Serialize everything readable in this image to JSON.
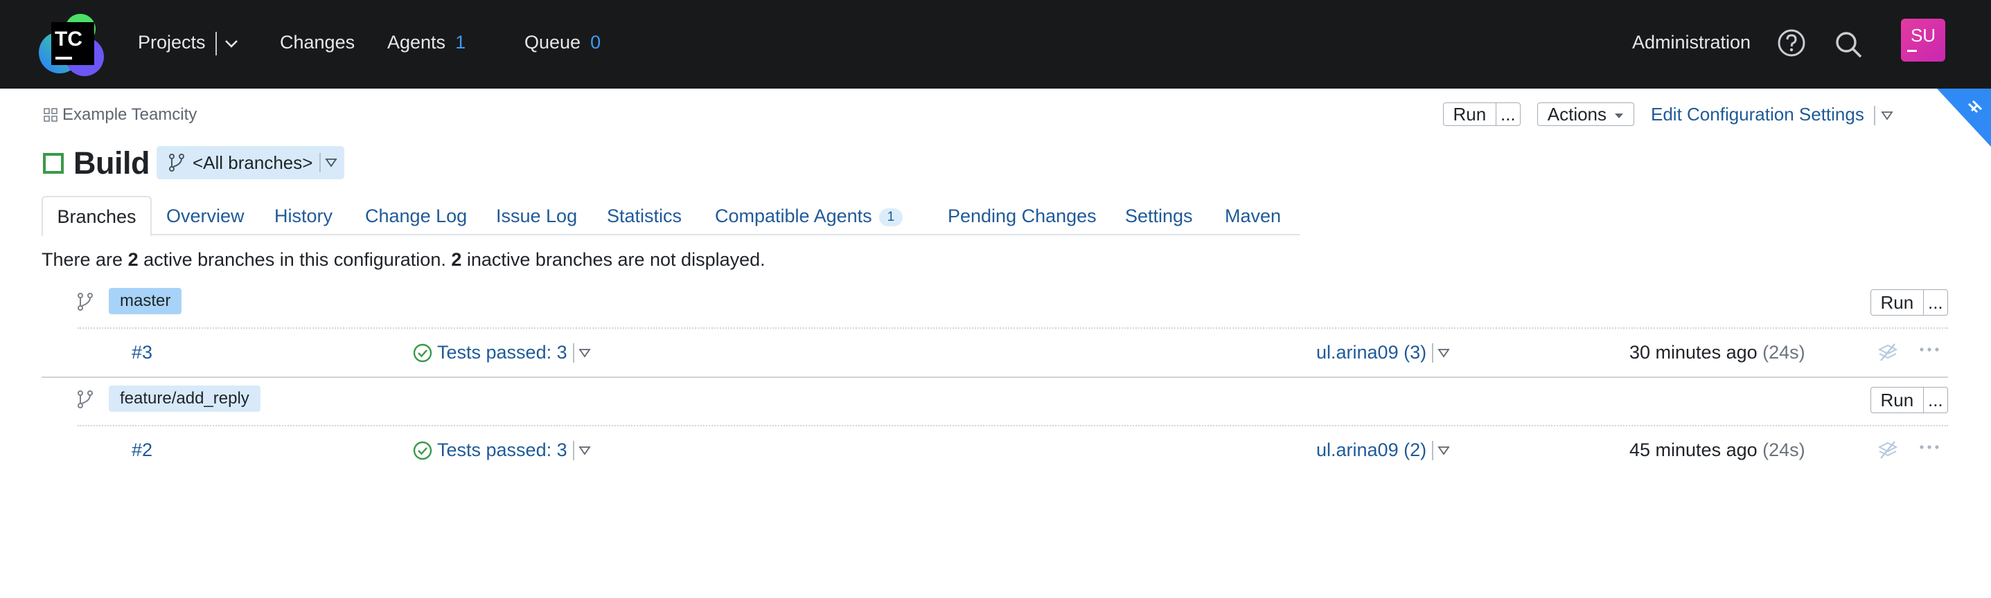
{
  "app": {
    "logo_text": "TC",
    "nav": {
      "projects": "Projects",
      "changes": "Changes",
      "agents": "Agents",
      "agents_count": "1",
      "queue": "Queue",
      "queue_count": "0",
      "administration": "Administration"
    },
    "avatar_initials": "SU",
    "colors": {
      "topbar": "#18191b",
      "link": "#1f5a99",
      "accent": "#3f99f2",
      "success": "#3b9a49",
      "avatar": "#d530a8"
    }
  },
  "header": {
    "breadcrumb": "Example Teamcity",
    "title": "Build",
    "branch_selector": "<All branches>",
    "run_label": "Run",
    "run_more_label": "...",
    "actions_label": "Actions",
    "edit_settings_label": "Edit Configuration Settings"
  },
  "tabs": [
    {
      "label": "Branches",
      "active": true
    },
    {
      "label": "Overview"
    },
    {
      "label": "History"
    },
    {
      "label": "Change Log"
    },
    {
      "label": "Issue Log"
    },
    {
      "label": "Statistics"
    },
    {
      "label": "Compatible Agents",
      "badge": "1"
    },
    {
      "label": "Pending Changes"
    },
    {
      "label": "Settings"
    },
    {
      "label": "Maven"
    }
  ],
  "summary": {
    "prefix": "There are ",
    "active_count": "2",
    "middle": " active branches in this configuration. ",
    "inactive_count": "2",
    "suffix": " inactive branches are not displayed."
  },
  "branches": [
    {
      "name": "master",
      "run_label": "Run",
      "more_label": "...",
      "build": {
        "number": "#3",
        "status": "Tests passed: 3",
        "user": "ul.arina09 (3)",
        "time": "30 minutes ago",
        "duration": "(24s)"
      }
    },
    {
      "name": "feature/add_reply",
      "run_label": "Run",
      "more_label": "...",
      "build": {
        "number": "#2",
        "status": "Tests passed: 3",
        "user": "ul.arina09 (2)",
        "time": "45 minutes ago",
        "duration": "(24s)"
      }
    }
  ],
  "icons": [
    "teamcity-logo-icon",
    "chevron-down-icon",
    "help-icon",
    "search-icon",
    "breadcrumb-grid-icon",
    "branch-icon",
    "check-circle-icon",
    "triangle-down-icon",
    "artifacts-icon",
    "more-icon",
    "corner-pin-icon"
  ]
}
